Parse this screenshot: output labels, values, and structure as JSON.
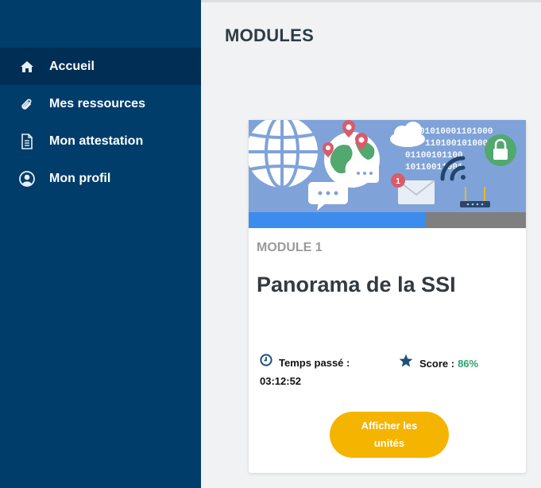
{
  "sidebar": {
    "items": [
      {
        "label": "Accueil",
        "icon": "home-icon",
        "active": true
      },
      {
        "label": "Mes ressources",
        "icon": "paperclip-icon"
      },
      {
        "label": "Mon attestation",
        "icon": "document-icon"
      },
      {
        "label": "Mon profil",
        "icon": "user-circle-icon"
      }
    ]
  },
  "page": {
    "title": "MODULES"
  },
  "module_card": {
    "banner": {
      "binary_rows": [
        "01010001101000",
        "1101001010001",
        "01100101100",
        "10110011001"
      ],
      "notification_count": "1"
    },
    "progress": 0.64,
    "label": "MODULE 1",
    "title": "Panorama de la SSI",
    "time_label": "Temps passé :",
    "time_value": "03:12:52",
    "score_label": "Score :",
    "score_value": "86%",
    "button_label": "Afficher les unités"
  },
  "colors": {
    "sidebar_bg": "#003d6b",
    "sidebar_active": "#002e54",
    "accent_button": "#f5b400",
    "progress_fill": "#3b8ced",
    "progress_track": "#7f7f7f",
    "score_green": "#2aa46a",
    "banner_bg": "#7fa3d8"
  }
}
